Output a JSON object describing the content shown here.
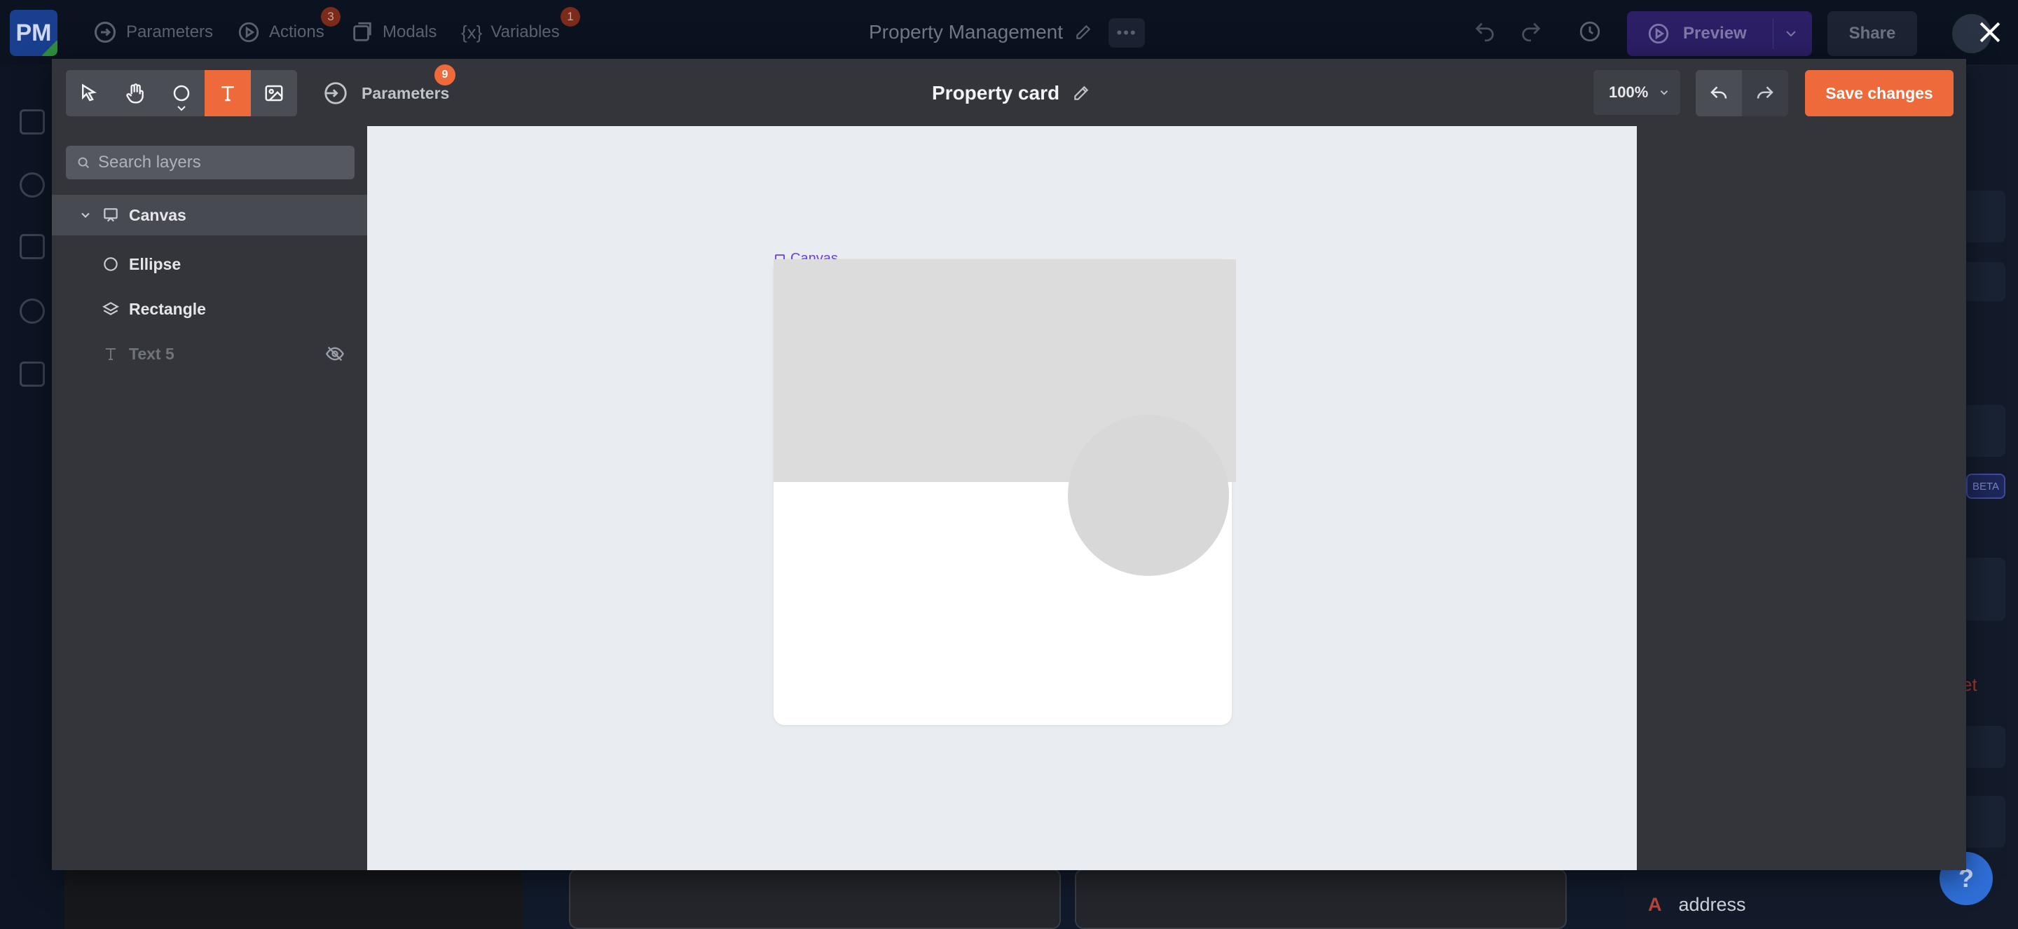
{
  "app": {
    "logo": "PM",
    "title": "Property Management",
    "nav": [
      {
        "label": "Parameters",
        "icon": "parameters-icon"
      },
      {
        "label": "Actions",
        "icon": "actions-icon",
        "badge": "3"
      },
      {
        "label": "Modals",
        "icon": "modals-icon"
      },
      {
        "label": "Variables",
        "icon": "variables-icon",
        "badge": "1"
      }
    ],
    "more": "•••",
    "preview_label": "Preview",
    "share_label": "Share",
    "beta_label": "BETA",
    "right_field": "address",
    "right_field_type": "A",
    "help": "?"
  },
  "editor": {
    "tools": [
      {
        "name": "select-tool",
        "icon": "pointer-icon"
      },
      {
        "name": "pan-tool",
        "icon": "hand-icon"
      },
      {
        "name": "ellipse-tool",
        "icon": "circle-icon"
      },
      {
        "name": "text-tool",
        "icon": "text-icon",
        "active": true
      },
      {
        "name": "image-tool",
        "icon": "image-icon"
      }
    ],
    "parameters_label": "Parameters",
    "parameters_badge": "9",
    "title": "Property card",
    "zoom": "100%",
    "save_label": "Save changes",
    "search_placeholder": "Search layers",
    "layers": [
      {
        "label": "Canvas",
        "icon": "frame-icon",
        "selected": true,
        "expanded": true
      },
      {
        "label": "Ellipse",
        "icon": "circle-icon"
      },
      {
        "label": "Rectangle",
        "icon": "layers-icon"
      },
      {
        "label": "Text 5",
        "icon": "text-icon",
        "hidden": true
      }
    ],
    "canvas_label": "Canvas"
  },
  "colors": {
    "accent": "#ef6a3a",
    "canvas_label": "#6a3cf0",
    "modal_bg": "#33353b",
    "canvas_bg": "#e9ecf0"
  }
}
